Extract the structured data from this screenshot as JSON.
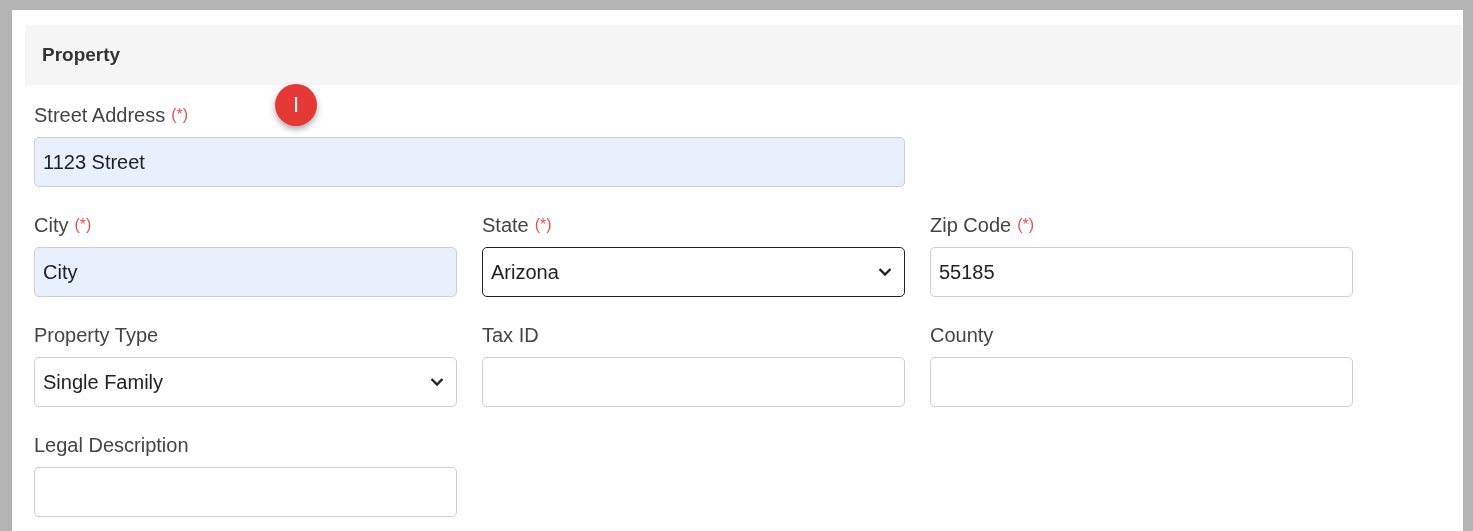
{
  "section": {
    "title": "Property"
  },
  "badge": {
    "text": "I"
  },
  "fields": [
    {
      "label": "Street Address",
      "required_mark": "(*)",
      "kind": "text",
      "value": "1123 Street",
      "autofilled": true,
      "focused": false
    },
    {
      "label": "City",
      "required_mark": "(*)",
      "kind": "text",
      "value": "City",
      "autofilled": true,
      "focused": false
    },
    {
      "label": "State",
      "required_mark": "(*)",
      "kind": "select",
      "value": "Arizona",
      "autofilled": false,
      "focused": true
    },
    {
      "label": "Zip Code",
      "required_mark": "(*)",
      "kind": "text",
      "value": "55185",
      "autofilled": false,
      "focused": false
    },
    {
      "label": "Property Type",
      "kind": "select",
      "value": "Single Family",
      "autofilled": false,
      "focused": false
    },
    {
      "label": "Tax ID",
      "kind": "text",
      "autofilled": false,
      "focused": false
    },
    {
      "label": "County",
      "kind": "text",
      "autofilled": false,
      "focused": false
    },
    {
      "label": "Legal Description",
      "kind": "text",
      "autofilled": false,
      "focused": false
    }
  ]
}
